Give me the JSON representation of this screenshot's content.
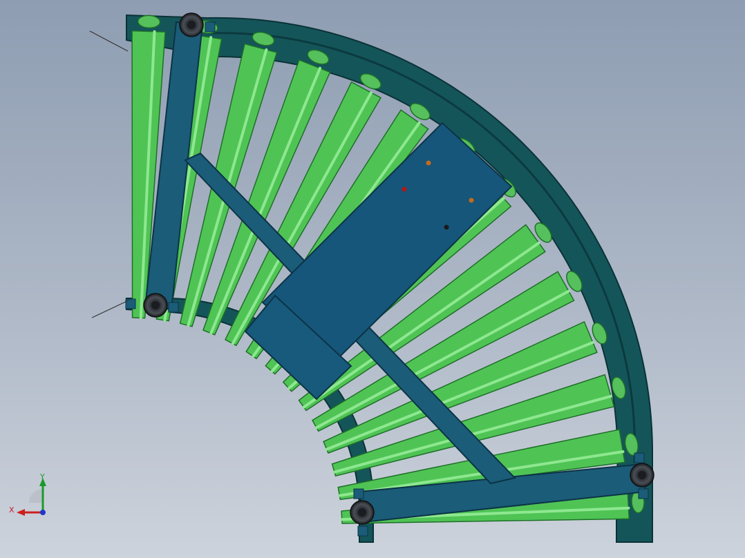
{
  "viewport": {
    "background_top": "#8e9db2",
    "background_bottom": "#cdd3dc"
  },
  "model": {
    "part": "curved-roller-conveyor",
    "colors": {
      "frame": "#14555a",
      "frame_edge": "#0a3236",
      "crossbar": "#1b5c78",
      "crossbar_edge": "#0c3346",
      "roller_light": "#7de07f",
      "roller_mid": "#4fc455",
      "roller_dark": "#2a8a33",
      "sprocket": "#55c05c",
      "wheel": "#2b2f35",
      "hole_orange": "#c86a1a",
      "hole_red": "#b01818"
    }
  },
  "triad": {
    "x_label": "X",
    "y_label": "Y",
    "x_color": "#cc1f1f",
    "y_color": "#1a9a2a",
    "z_color": "#1f38c8"
  }
}
